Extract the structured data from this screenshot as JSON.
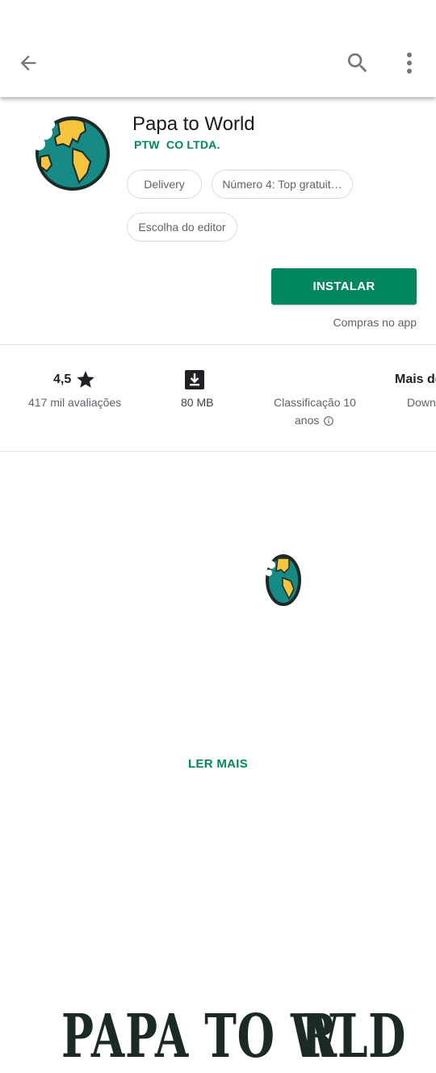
{
  "toolbar": {
    "back_icon": "arrow-back-icon",
    "search_icon": "search-icon",
    "more_icon": "more-vert-icon"
  },
  "app": {
    "title": "Papa to World",
    "developer": "PTW  CO LTDA.",
    "chips": [
      "Delivery",
      "Número 4: Top gratuit…",
      "Escolha do editor"
    ],
    "install_label": "INSTALAR",
    "in_app_purchases": "Compras no app"
  },
  "stats": {
    "rating_value": "4,5",
    "rating_label": "417 mil avaliações",
    "size_value": "80 MB",
    "classification_line1": "Classificação 10",
    "classification_line2": "anos",
    "downloads_value": "Mais de",
    "downloads_label": "Down"
  },
  "banner": {
    "logo_part1": "PAPA TO W",
    "logo_part2": "RLD"
  },
  "read_more": "LER MAIS",
  "colors": {
    "accent": "#01875f",
    "globe_ocean": "#168a85",
    "globe_land": "#f7c53c",
    "outline": "#1c2a26"
  }
}
